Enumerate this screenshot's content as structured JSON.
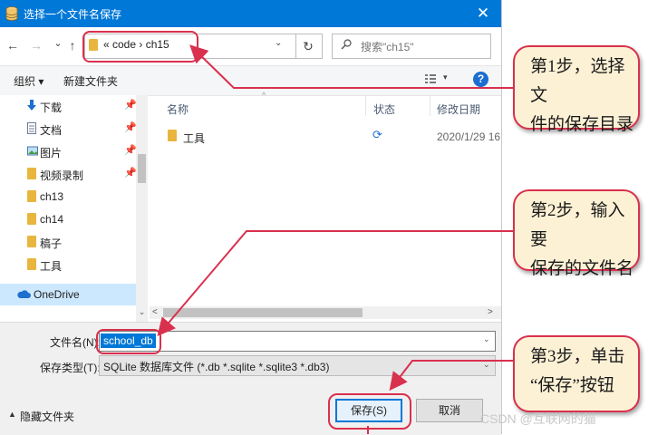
{
  "window": {
    "title": "选择一个文件名保存",
    "close_glyph": "✕"
  },
  "nav": {
    "back": "←",
    "forward": "→",
    "recent": "⌄",
    "up": "↑",
    "refresh": "↻"
  },
  "address": {
    "path_text": "« code  ›  ch15",
    "dropdown": "⌄"
  },
  "search": {
    "placeholder": "搜索\"ch15\""
  },
  "toolbar": {
    "organize": "组织 ▾",
    "new_folder": "新建文件夹",
    "view_dropdown": "▾",
    "help": "?"
  },
  "sidebar": {
    "items": [
      {
        "label": "下载",
        "icon": "download-arrow-icon",
        "pinned": true
      },
      {
        "label": "文档",
        "icon": "document-icon",
        "pinned": true
      },
      {
        "label": "图片",
        "icon": "picture-icon",
        "pinned": true
      },
      {
        "label": "视频录制",
        "icon": "folder-icon",
        "pinned": true
      },
      {
        "label": "ch13",
        "icon": "folder-icon",
        "pinned": false
      },
      {
        "label": "ch14",
        "icon": "folder-icon",
        "pinned": false
      },
      {
        "label": "稿子",
        "icon": "folder-icon",
        "pinned": false
      },
      {
        "label": "工具",
        "icon": "folder-icon",
        "pinned": false
      }
    ],
    "onedrive": "OneDrive",
    "pin_glyph": "📌"
  },
  "list": {
    "columns": [
      "名称",
      "状态",
      "修改日期"
    ],
    "rows": [
      {
        "name": "工具",
        "status_icon": "sync-icon",
        "status_glyph": "⟳",
        "date": "2020/1/29 16"
      }
    ]
  },
  "form": {
    "filename_label": "文件名(N):",
    "filename_value": "school_db",
    "filetype_label": "保存类型(T):",
    "filetype_value": "SQLite 数据库文件 (*.db *.sqlite *.sqlite3 *.db3)",
    "hide_folders": "隐藏文件夹",
    "hide_glyph": "▲",
    "save": "保存(S)",
    "cancel": "取消"
  },
  "annotations": {
    "step1": [
      "第1步，选择文",
      "件的保存目录"
    ],
    "step2": [
      "第2步，输入要",
      "保存的文件名"
    ],
    "step3": [
      "第3步，单击",
      "“保存”按钮"
    ],
    "accent_color": "#d9304e",
    "bubble_color": "#fdf1d5"
  },
  "watermark": "CSDN @互联网的猫",
  "colors": {
    "titlebar": "#0078d7",
    "folder": "#e8b63e",
    "selection": "#0078d7"
  }
}
